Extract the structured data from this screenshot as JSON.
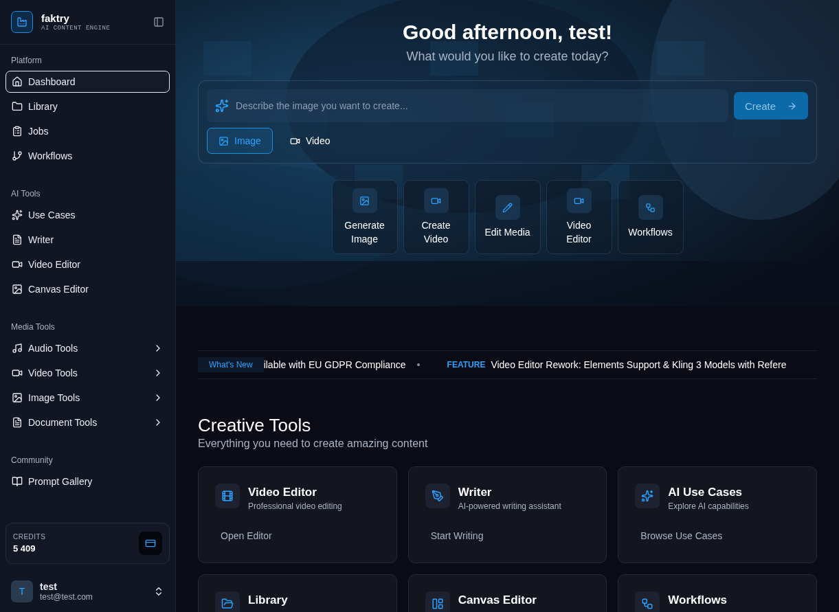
{
  "brand": {
    "name": "faktry",
    "tagline": "AI CONTENT ENGINE"
  },
  "sidebar": {
    "sections": [
      {
        "title": "Platform",
        "items": [
          {
            "label": "Dashboard",
            "kind": "link",
            "selected": true
          },
          {
            "label": "Library",
            "kind": "link",
            "selected": false
          },
          {
            "label": "Jobs",
            "kind": "link",
            "selected": false
          },
          {
            "label": "Workflows",
            "kind": "link",
            "selected": false
          }
        ]
      },
      {
        "title": "AI Tools",
        "items": [
          {
            "label": "Use Cases",
            "kind": "link",
            "selected": false
          },
          {
            "label": "Writer",
            "kind": "link",
            "selected": false
          },
          {
            "label": "Video Editor",
            "kind": "link",
            "selected": false
          },
          {
            "label": "Canvas Editor",
            "kind": "link",
            "selected": false
          }
        ]
      },
      {
        "title": "Media Tools",
        "items": [
          {
            "label": "Audio Tools",
            "kind": "group",
            "selected": false
          },
          {
            "label": "Video Tools",
            "kind": "group",
            "selected": false
          },
          {
            "label": "Image Tools",
            "kind": "group",
            "selected": false
          },
          {
            "label": "Document Tools",
            "kind": "group",
            "selected": false
          }
        ]
      },
      {
        "title": "Community",
        "items": [
          {
            "label": "Prompt Gallery",
            "kind": "link",
            "selected": false
          }
        ]
      }
    ]
  },
  "credits": {
    "label": "CREDITS",
    "value": "5 409"
  },
  "user": {
    "initial": "T",
    "name": "test",
    "email": "test@test.com"
  },
  "hero": {
    "greeting": "Good afternoon, test!",
    "subtitle": "What would you like to create today?",
    "prompt": {
      "placeholder": "Describe the image you want to create...",
      "button": "Create"
    },
    "modes": [
      {
        "label": "Image",
        "selected": true
      },
      {
        "label": "Video",
        "selected": false
      }
    ],
    "quick_actions": [
      "Generate Image",
      "Create Video",
      "Edit Media",
      "Video Editor",
      "Workflows"
    ]
  },
  "ticker": {
    "label": "What's New",
    "items": [
      {
        "kind": "plain",
        "text": "ilable with EU GDPR Compliance"
      },
      {
        "kind": "tagged",
        "tag": "FEATURE",
        "text": "Video Editor Rework: Elements Support & Kling 3 Models with Refere"
      }
    ]
  },
  "creative_tools": {
    "title": "Creative Tools",
    "subtitle": "Everything you need to create amazing content",
    "cards": [
      {
        "title": "Video Editor",
        "description": "Professional video editing",
        "action": "Open Editor"
      },
      {
        "title": "Writer",
        "description": "AI-powered writing assistant",
        "action": "Start Writing"
      },
      {
        "title": "AI Use Cases",
        "description": "Explore AI capabilities",
        "action": "Browse Use Cases"
      },
      {
        "title": "Library"
      },
      {
        "title": "Canvas Editor"
      },
      {
        "title": "Workflows"
      }
    ]
  }
}
